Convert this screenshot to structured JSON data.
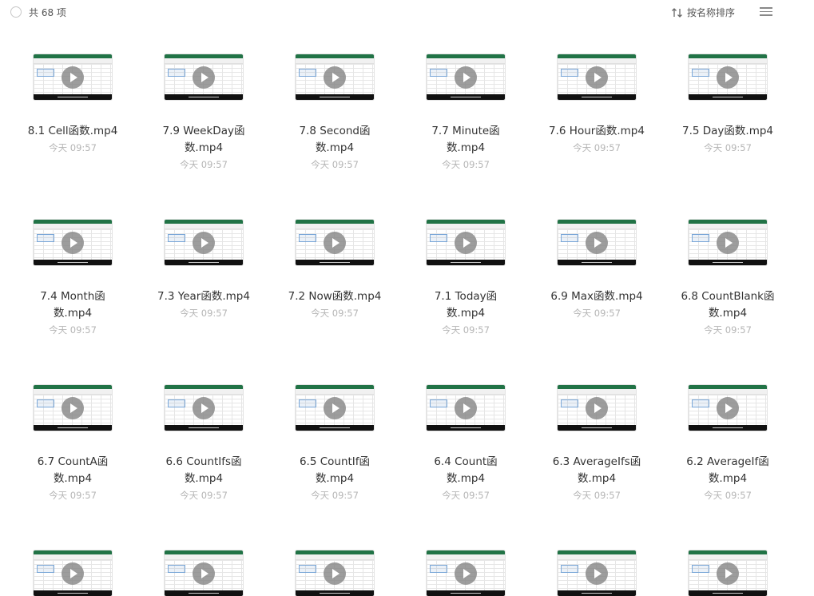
{
  "header": {
    "count_label": "共 68 项",
    "sort_label": "按名称排序"
  },
  "colors": {
    "excel_green": "#217346",
    "time_gray": "#b5b5b5"
  },
  "items": [
    {
      "name_lines": [
        "8.1 Cell函数.mp4"
      ],
      "time": "今天 09:57"
    },
    {
      "name_lines": [
        "7.9 WeekDay函",
        "数.mp4"
      ],
      "time": "今天 09:57"
    },
    {
      "name_lines": [
        "7.8 Second函",
        "数.mp4"
      ],
      "time": "今天 09:57"
    },
    {
      "name_lines": [
        "7.7 Minute函",
        "数.mp4"
      ],
      "time": "今天 09:57"
    },
    {
      "name_lines": [
        "7.6 Hour函数.mp4"
      ],
      "time": "今天 09:57"
    },
    {
      "name_lines": [
        "7.5 Day函数.mp4"
      ],
      "time": "今天 09:57"
    },
    {
      "name_lines": [
        "7.4 Month函",
        "数.mp4"
      ],
      "time": "今天 09:57"
    },
    {
      "name_lines": [
        "7.3 Year函数.mp4"
      ],
      "time": "今天 09:57"
    },
    {
      "name_lines": [
        "7.2 Now函数.mp4"
      ],
      "time": "今天 09:57"
    },
    {
      "name_lines": [
        "7.1 Today函",
        "数.mp4"
      ],
      "time": "今天 09:57"
    },
    {
      "name_lines": [
        "6.9 Max函数.mp4"
      ],
      "time": "今天 09:57"
    },
    {
      "name_lines": [
        "6.8 CountBlank函",
        "数.mp4"
      ],
      "time": "今天 09:57"
    },
    {
      "name_lines": [
        "6.7 CountA函",
        "数.mp4"
      ],
      "time": "今天 09:57"
    },
    {
      "name_lines": [
        "6.6 CountIfs函",
        "数.mp4"
      ],
      "time": "今天 09:57"
    },
    {
      "name_lines": [
        "6.5 CountIf函",
        "数.mp4"
      ],
      "time": "今天 09:57"
    },
    {
      "name_lines": [
        "6.4 Count函",
        "数.mp4"
      ],
      "time": "今天 09:57"
    },
    {
      "name_lines": [
        "6.3 AverageIfs函",
        "数.mp4"
      ],
      "time": "今天 09:57"
    },
    {
      "name_lines": [
        "6.2 AverageIf函",
        "数.mp4"
      ],
      "time": "今天 09:57"
    },
    {
      "name_lines": [],
      "time": ""
    },
    {
      "name_lines": [],
      "time": ""
    },
    {
      "name_lines": [],
      "time": ""
    },
    {
      "name_lines": [],
      "time": ""
    },
    {
      "name_lines": [],
      "time": ""
    },
    {
      "name_lines": [],
      "time": ""
    }
  ]
}
